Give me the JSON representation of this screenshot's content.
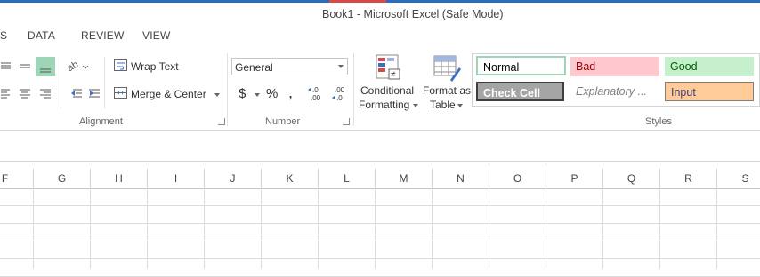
{
  "window": {
    "title": "Book1 - Microsoft Excel (Safe Mode)"
  },
  "tabs": [
    "S",
    "DATA",
    "REVIEW",
    "VIEW"
  ],
  "alignment": {
    "wrap_text": "Wrap Text",
    "merge_center": "Merge & Center",
    "group_label": "Alignment"
  },
  "number": {
    "format_value": "General",
    "currency_symbol": "$",
    "percent_symbol": "%",
    "comma_symbol": ",",
    "increase_decimal": "←.0\n.00",
    "decrease_decimal": ".00\n→.0",
    "group_label": "Number"
  },
  "styles_group": {
    "conditional_formatting": [
      "Conditional",
      "Formatting"
    ],
    "format_as_table": [
      "Format as",
      "Table"
    ],
    "group_label": "Styles",
    "cells": [
      {
        "label": "Normal",
        "bg": "#ffffff",
        "color": "#000000"
      },
      {
        "label": "Bad",
        "bg": "#ffc7ce",
        "color": "#9c0006"
      },
      {
        "label": "Good",
        "bg": "#c6efce",
        "color": "#006100"
      },
      {
        "label": "Check Cell",
        "bg": "#a5a5a5",
        "color": "#ffffff"
      },
      {
        "label": "Explanatory ...",
        "bg": "#ffffff",
        "color": "#7f7f7f"
      },
      {
        "label": "Input",
        "bg": "#ffcc99",
        "color": "#3f3f76"
      }
    ]
  },
  "columns": [
    "F",
    "G",
    "H",
    "I",
    "J",
    "K",
    "L",
    "M",
    "N",
    "O",
    "P",
    "Q",
    "R",
    "S"
  ],
  "colors": {
    "accent_blue": "#2a6cc0",
    "selected_align": "#9fd5b7"
  }
}
